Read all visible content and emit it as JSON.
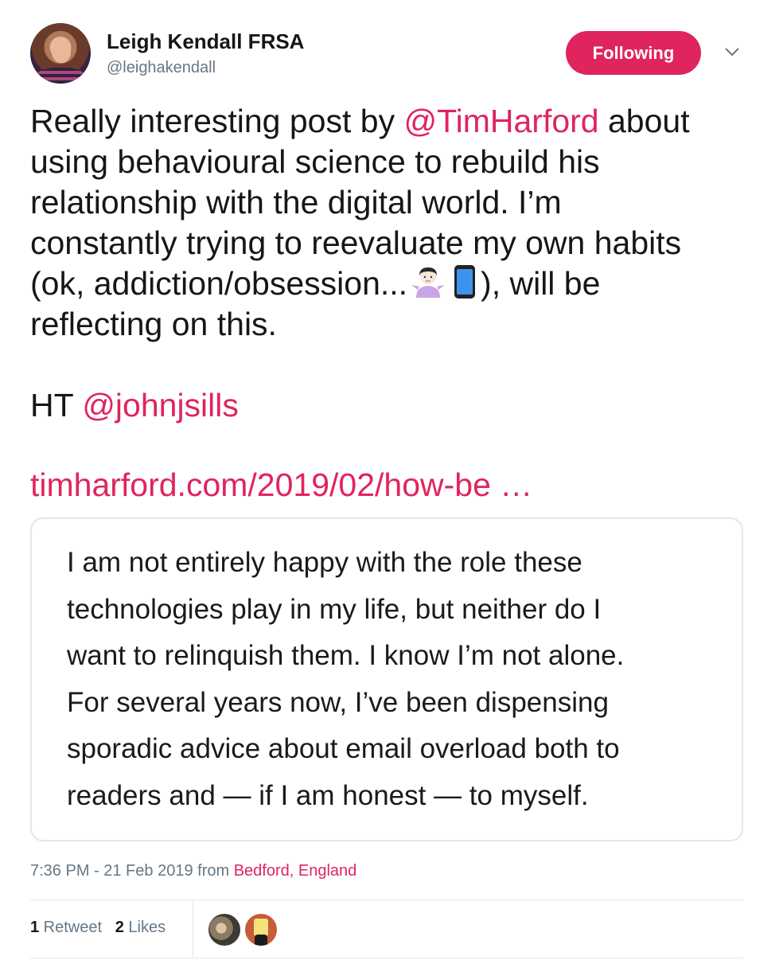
{
  "author": {
    "display_name": "Leigh Kendall FRSA",
    "handle": "@leighakendall"
  },
  "follow_button": {
    "label": "Following"
  },
  "tweet": {
    "line1_pre": "Really interesting post by ",
    "mention1": "@TimHarford",
    "line1_post": " about",
    "line2": "using behavioural science to rebuild his",
    "line3": "relationship with the digital world. I’m",
    "line4": "constantly trying to reevaluate my own habits",
    "line5_pre": "(ok, addiction/obsession...",
    "line5_post": "), will be",
    "line6": "reflecting on this.",
    "ht_prefix": "HT ",
    "mention2": "@johnjsills",
    "link": "timharford.com/2019/02/how-be  …",
    "emojis": [
      "person-shrugging-icon",
      "mobile-phone-icon"
    ]
  },
  "card": {
    "quote_lines": [
      "I am not entirely happy with the role these",
      "technologies play in my life, but neither do I",
      "want to relinquish them. I know I’m not alone.",
      "For several years now, I’ve been dispensing",
      "sporadic advice about email overload both to",
      "readers and — if I am honest — to myself."
    ]
  },
  "meta": {
    "timestamp": "7:36 PM - 21 Feb 2019",
    "from": " from ",
    "location": "Bedford, England"
  },
  "stats": {
    "retweet_count": "1",
    "retweet_label": " Retweet",
    "like_count": "2",
    "like_label": " Likes"
  },
  "colors": {
    "accent": "#e0245e",
    "text": "#14171a",
    "secondary": "#657786",
    "border": "#e1e8ed"
  }
}
